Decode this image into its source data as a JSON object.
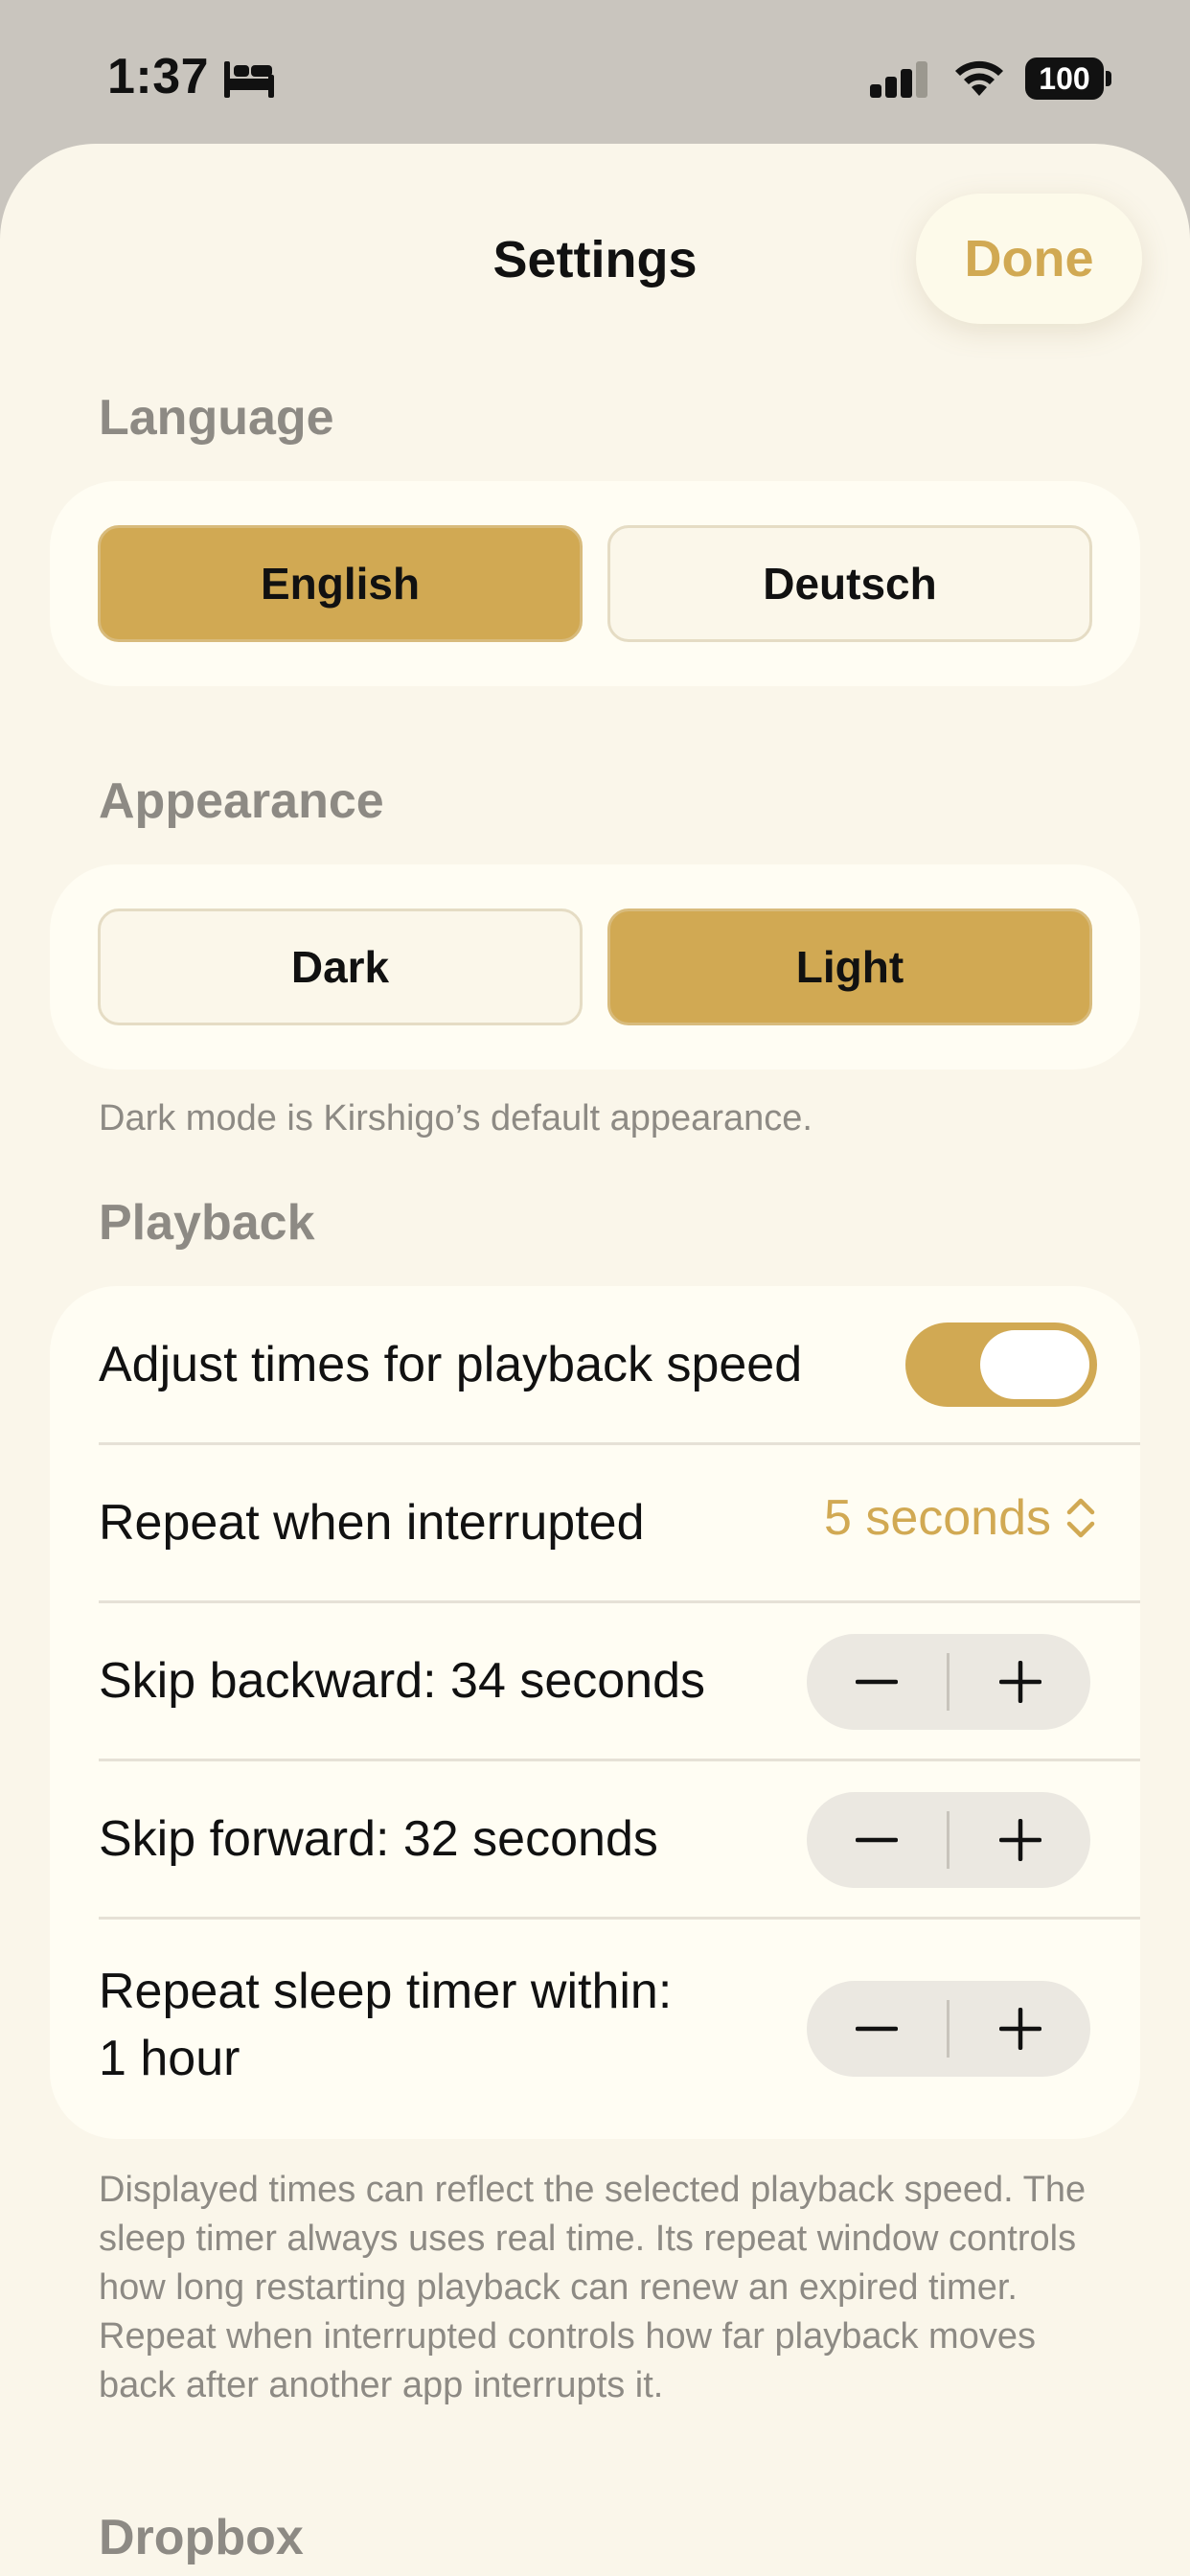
{
  "status_bar": {
    "time": "1:37",
    "battery": "100",
    "focus_icon": "bed-icon",
    "signal_icon": "cellular-signal-icon",
    "wifi_icon": "wifi-icon"
  },
  "header": {
    "title": "Settings",
    "done_label": "Done"
  },
  "language": {
    "header": "Language",
    "options": [
      "English",
      "Deutsch"
    ],
    "selected": "English"
  },
  "appearance": {
    "header": "Appearance",
    "options": [
      "Dark",
      "Light"
    ],
    "selected": "Light",
    "footnote": "Dark mode is Kirshigo’s default appearance."
  },
  "playback": {
    "header": "Playback",
    "adjust_times_label": "Adjust times for playback speed",
    "adjust_times_on": true,
    "repeat_interrupted_label": "Repeat when interrupted",
    "repeat_interrupted_value": "5 seconds",
    "skip_backward_label": "Skip backward: 34 seconds",
    "skip_forward_label": "Skip forward: 32 seconds",
    "sleep_timer_label_line1": "Repeat sleep timer within:",
    "sleep_timer_label_line2": "1 hour",
    "footnote": "Displayed times can reflect the selected playback speed. The sleep timer always uses real time. Its repeat window controls how long restarting playback can renew an expired timer. Repeat when interrupted controls how far playback moves back after another app interrupts it."
  },
  "dropbox": {
    "header": "Dropbox"
  },
  "colors": {
    "accent": "#d1a953",
    "background": "#faf6ea",
    "card": "#fffdf3",
    "secondary_text": "#8d8a84"
  }
}
